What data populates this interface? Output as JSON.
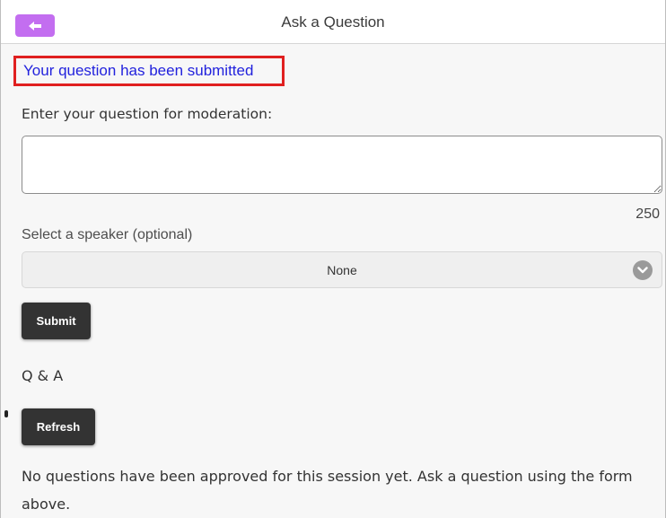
{
  "header": {
    "title": "Ask a Question",
    "back_icon": "arrow-left-icon",
    "accent_color": "#c36ef0"
  },
  "status": {
    "message": "Your question has been submitted",
    "message_color": "#2222dd",
    "highlight_color": "#e02020"
  },
  "question": {
    "label": "Enter your question for moderation:",
    "value": "",
    "remaining_chars": "250"
  },
  "speaker": {
    "label": "Select a speaker (optional)",
    "selected": "None",
    "icon": "chevron-down-icon"
  },
  "buttons": {
    "submit_label": "Submit",
    "refresh_label": "Refresh"
  },
  "qa": {
    "heading": "Q & A",
    "empty_message": "No questions have been approved for this session yet. Ask a question using the form above."
  }
}
